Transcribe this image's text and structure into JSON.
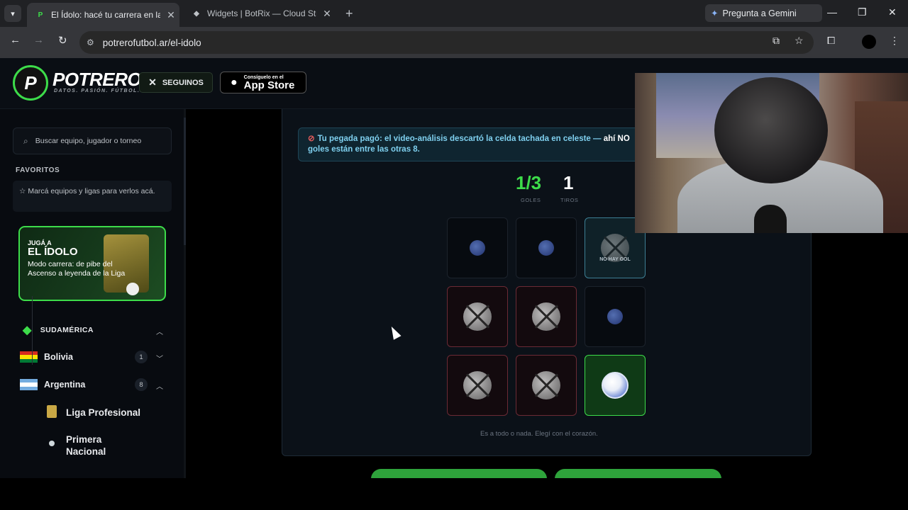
{
  "browser": {
    "tabs": [
      {
        "title": "El Ídolo: hacé tu carrera en la Liga",
        "favicon": "P",
        "active": true
      },
      {
        "title": "Widgets | BotRix — Cloud Streaming",
        "favicon": "◆",
        "active": false
      }
    ],
    "gemini_label": "Pregunta a Gemini",
    "url": "potrerofutbol.ar/el-idolo"
  },
  "header": {
    "logo_text": "POTRERO",
    "logo_sub": "DATOS. PASIÓN. FÚTBOL.",
    "seguinos": "SEGUINOS",
    "appstore_small": "Consíguelo en el",
    "appstore_large": "App Store"
  },
  "sidebar": {
    "search_placeholder": "Buscar equipo, jugador o torneo",
    "favorites_heading": "FAVORITOS",
    "favorites_hint": "Marcá equipos y ligas para verlos acá.",
    "promo": {
      "kicker": "JUGÁ A",
      "title": "EL ÍDOLO",
      "desc": "Modo carrera: de pibe del Ascenso a leyenda de la Liga"
    },
    "region": "SUDAMÉRICA",
    "countries": [
      {
        "name": "Bolivia",
        "count": "1"
      },
      {
        "name": "Argentina",
        "count": "8"
      }
    ],
    "leagues": [
      "Liga Profesional",
      "Primera Nacional"
    ]
  },
  "game": {
    "alert_main": "Tu pegada pagó: el video-análisis descartó la celda tachada en celeste —",
    "alert_strong": "ahí NO",
    "alert_rest": "goles están entre las otras 8.",
    "goals_value": "1/3",
    "goals_label": "GOLES",
    "shots_value": "1",
    "shots_label": "TIROS",
    "no_goal_label": "NO HAY GOL",
    "footnote": "Es a todo o nada. Elegí con el corazón.",
    "grid": [
      "unknown",
      "unknown",
      "nogol",
      "miss",
      "miss",
      "unknown",
      "miss",
      "miss",
      "goal"
    ]
  },
  "colors": {
    "accent": "#3ddc4a",
    "info": "#7fd0ef",
    "miss": "#6b2a35"
  }
}
